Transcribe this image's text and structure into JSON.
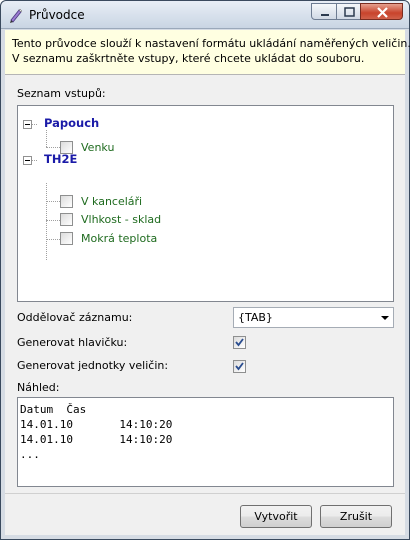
{
  "window": {
    "title": "Průvodce"
  },
  "info": {
    "line1": "Tento průvodce slouží k nastavení formátu ukládání naměřených veličin.",
    "line2": "V seznamu zaškrtněte vstupy, které chcete ukládat do souboru."
  },
  "inputs": {
    "label": "Seznam vstupů:",
    "groups": [
      {
        "name": "Papouch",
        "expanded": true,
        "items": [
          {
            "label": "Venku",
            "checked": false
          }
        ]
      },
      {
        "name": "TH2E",
        "expanded": true,
        "items": [
          {
            "label": "V kanceláři",
            "checked": false
          },
          {
            "label": "Vlhkost - sklad",
            "checked": false
          },
          {
            "label": "Mokrá teplota",
            "checked": false
          }
        ]
      }
    ]
  },
  "separator": {
    "label": "Oddělovač záznamu:",
    "value": "{TAB}"
  },
  "header": {
    "label": "Generovat hlavičku:",
    "checked": true
  },
  "units": {
    "label": "Generovat jednotky veličin:",
    "checked": true
  },
  "preview": {
    "label": "Náhled:",
    "lines": [
      "Datum  Čas",
      "14.01.10       14:10:20",
      "14.01.10       14:10:20",
      "..."
    ]
  },
  "buttons": {
    "create": "Vytvořit",
    "cancel": "Zrušit"
  },
  "colors": {
    "group": "#1b1ba8",
    "item": "#1f6b1f",
    "info_bg": "#ffffe1"
  }
}
